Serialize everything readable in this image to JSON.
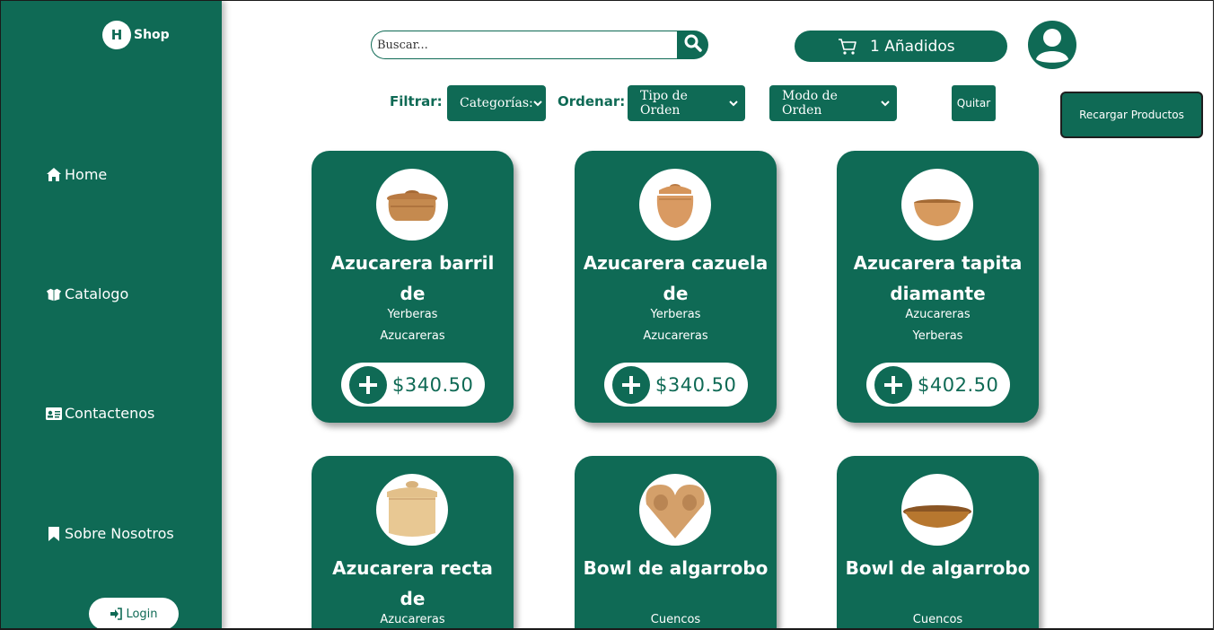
{
  "brand": {
    "logo_letter": "H",
    "logo_text": "Shop"
  },
  "sidebar": {
    "items": [
      {
        "label": "Home",
        "icon": "home-icon"
      },
      {
        "label": "Catalogo",
        "icon": "box-open-icon"
      },
      {
        "label": "Contactenos",
        "icon": "id-card-icon"
      },
      {
        "label": "Sobre Nosotros",
        "icon": "bookmark-icon"
      }
    ],
    "login_label": "Login"
  },
  "search": {
    "placeholder": "Buscar..."
  },
  "cart": {
    "label": "1 Añadidos"
  },
  "filters": {
    "filtrar_label": "Filtrar:",
    "ordenar_label": "Ordenar:",
    "categorias": "Categorías:",
    "tipo_orden": "Tipo de Orden",
    "modo_orden": "Modo de Orden",
    "quitar": "Quitar",
    "recargar": "Recargar Productos"
  },
  "products": [
    {
      "name": "Azucarera barril de",
      "tags": [
        "Yerberas",
        "Azucareras"
      ],
      "price": "$340.50"
    },
    {
      "name": "Azucarera cazuela de",
      "tags": [
        "Yerberas",
        "Azucareras"
      ],
      "price": "$340.50"
    },
    {
      "name": "Azucarera tapita diamante",
      "tags": [
        "Azucareras",
        "Yerberas"
      ],
      "price": "$402.50"
    },
    {
      "name": "Azucarera recta de",
      "tags": [
        "Azucareras"
      ],
      "price": ""
    },
    {
      "name": "Bowl de algarrobo",
      "tags": [
        "Cuencos"
      ],
      "price": ""
    },
    {
      "name": "Bowl de algarrobo",
      "tags": [
        "Cuencos"
      ],
      "price": ""
    }
  ],
  "colors": {
    "primary": "#0f6a55",
    "white": "#ffffff",
    "wood": "#c98a4e"
  }
}
